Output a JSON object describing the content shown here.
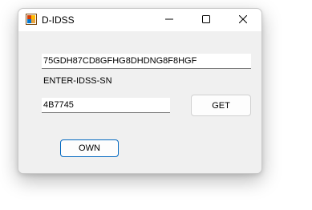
{
  "window": {
    "title": "D-IDSS",
    "icon": "app-icon",
    "controls": {
      "minimize_icon": "minimize-icon",
      "maximize_icon": "maximize-icon",
      "close_icon": "close-icon"
    }
  },
  "form": {
    "serial_value": "75GDH87CD8GFHG8DHDNG8F8HGF",
    "serial_label": "ENTER-IDSS-SN",
    "code_value": "4B7745",
    "get_button": "GET",
    "own_button": "OWN"
  },
  "colors": {
    "accent": "#0067c0",
    "window_bg": "#f0f0f0",
    "titlebar_bg": "#ffffff"
  }
}
